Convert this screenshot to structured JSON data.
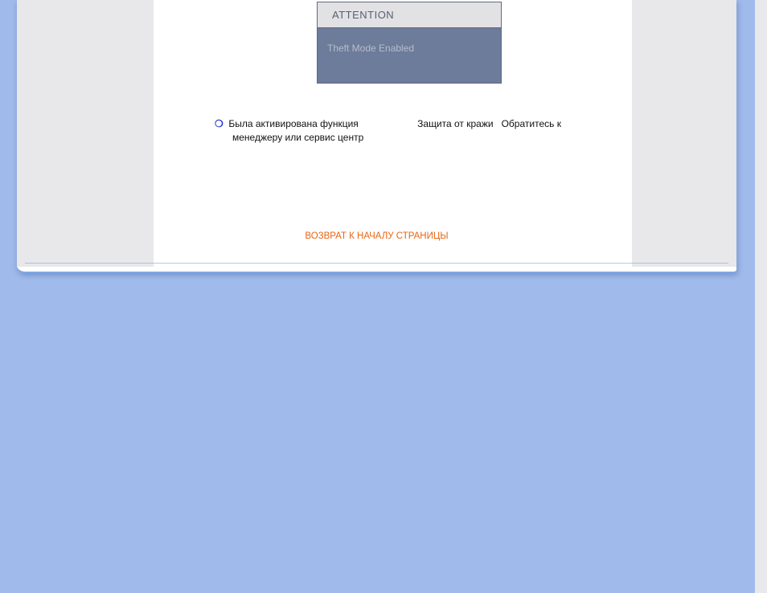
{
  "attention": {
    "header": "ATTENTION",
    "body": "Theft Mode Enabled"
  },
  "bullet": {
    "mark": "❍",
    "line1_part1": "Была активирована функция",
    "line1_part2": "Защита от кражи",
    "line1_part3": "Обратитесь к",
    "line2": "менеджеру или сервис центр"
  },
  "return_link": "ВОЗВРАТ К НАЧАЛУ СТРАНИЦЫ"
}
